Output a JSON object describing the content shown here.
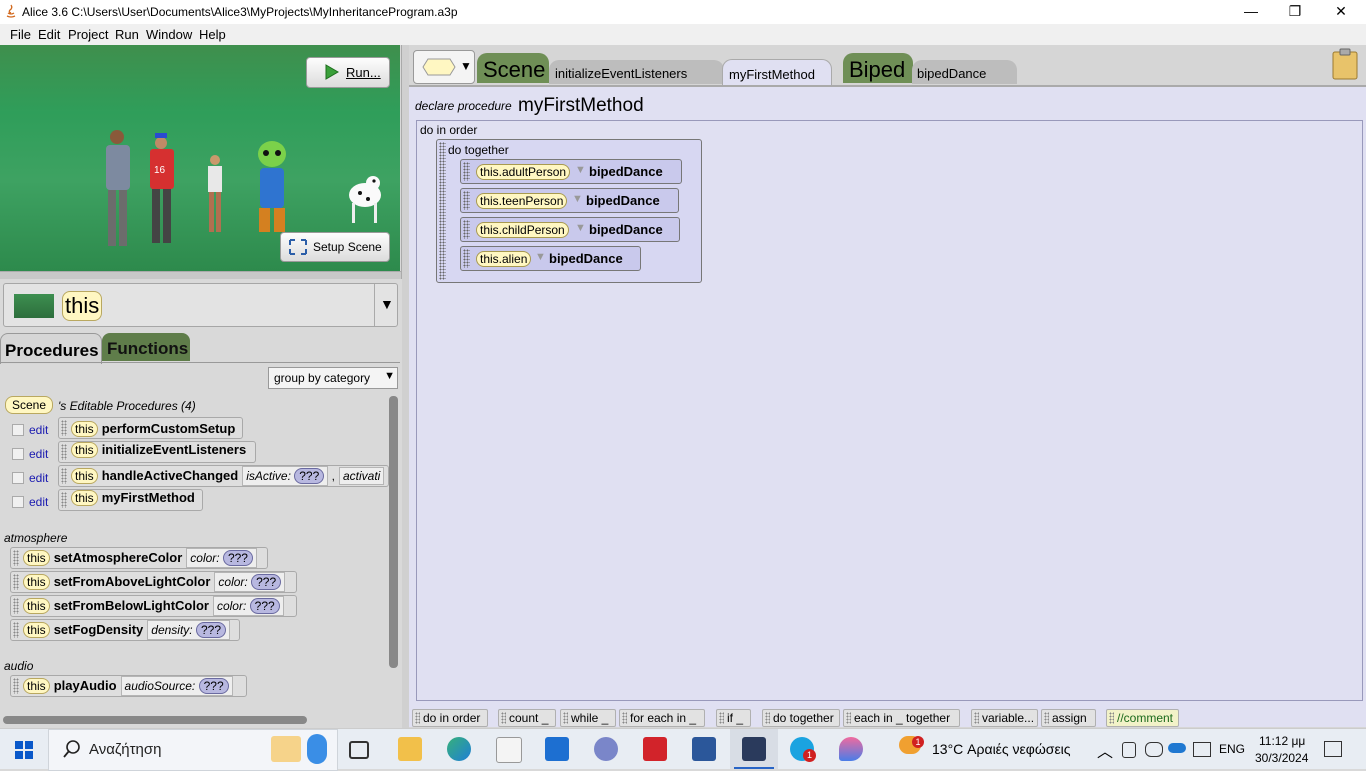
{
  "window": {
    "title": "Alice 3.6 C:\\Users\\User\\Documents\\Alice3\\MyProjects\\MyInheritanceProgram.a3p",
    "minimize": "—",
    "maximize": "❐",
    "close": "✕"
  },
  "menu": [
    "File",
    "Edit",
    "Project",
    "Run",
    "Window",
    "Help"
  ],
  "scene": {
    "run_label": "Run...",
    "setup_label": "Setup Scene"
  },
  "selector": {
    "value": "this",
    "dropdown": "▼"
  },
  "palette_tabs": {
    "procedures": "Procedures",
    "functions": "Functions"
  },
  "group_by": "group by category",
  "editable": {
    "owner": "Scene",
    "title": "'s Editable Procedures (4)",
    "items": [
      {
        "edit": "edit",
        "this": "this",
        "name": "performCustomSetup"
      },
      {
        "edit": "edit",
        "this": "this",
        "name": "initializeEventListeners"
      },
      {
        "edit": "edit",
        "this": "this",
        "name": "handleActiveChanged",
        "param1": "isActive:",
        "param1_val": "???",
        "sep": ",",
        "param2": "activati"
      },
      {
        "edit": "edit",
        "this": "this",
        "name": "myFirstMethod"
      }
    ]
  },
  "atmosphere": {
    "label": "atmosphere",
    "items": [
      {
        "this": "this",
        "name": "setAtmosphereColor",
        "param": "color:",
        "val": "???"
      },
      {
        "this": "this",
        "name": "setFromAboveLightColor",
        "param": "color:",
        "val": "???"
      },
      {
        "this": "this",
        "name": "setFromBelowLightColor",
        "param": "color:",
        "val": "???"
      },
      {
        "this": "this",
        "name": "setFogDensity",
        "param": "density:",
        "val": "???"
      }
    ]
  },
  "audio": {
    "label": "audio",
    "items": [
      {
        "this": "this",
        "name": "playAudio",
        "param": "audioSource:",
        "val": "???"
      }
    ]
  },
  "editor_tabs": {
    "scene": "Scene",
    "initialize": "initializeEventListeners",
    "myFirstMethod": "myFirstMethod",
    "biped": "Biped",
    "bipedDance": "bipedDance"
  },
  "declaration": {
    "prefix": "declare procedure",
    "name": "myFirstMethod"
  },
  "code": {
    "do_in_order": "do in order",
    "do_together": "do together",
    "statements": [
      {
        "target": "this.adultPerson",
        "method": "bipedDance"
      },
      {
        "target": "this.teenPerson",
        "method": "bipedDance"
      },
      {
        "target": "this.childPerson",
        "method": "bipedDance"
      },
      {
        "target": "this.alien",
        "method": "bipedDance"
      }
    ]
  },
  "control_palette": [
    "do in order",
    "count _",
    "while _",
    "for each in _",
    "if _",
    "do together",
    "each in _ together",
    "variable...",
    "assign",
    "//comment"
  ],
  "taskbar": {
    "search": "Αναζήτηση",
    "weather": "13°C  Αραιές νεφώσεις",
    "lang": "ENG",
    "time": "11:12 μμ",
    "date": "30/3/2024",
    "skype_badge": "1",
    "weather_badge": "1"
  },
  "colors": {
    "accent_tab": "#6f8f56",
    "code_bg": "#e0e0f2",
    "chip_bg": "#fff7c2"
  }
}
